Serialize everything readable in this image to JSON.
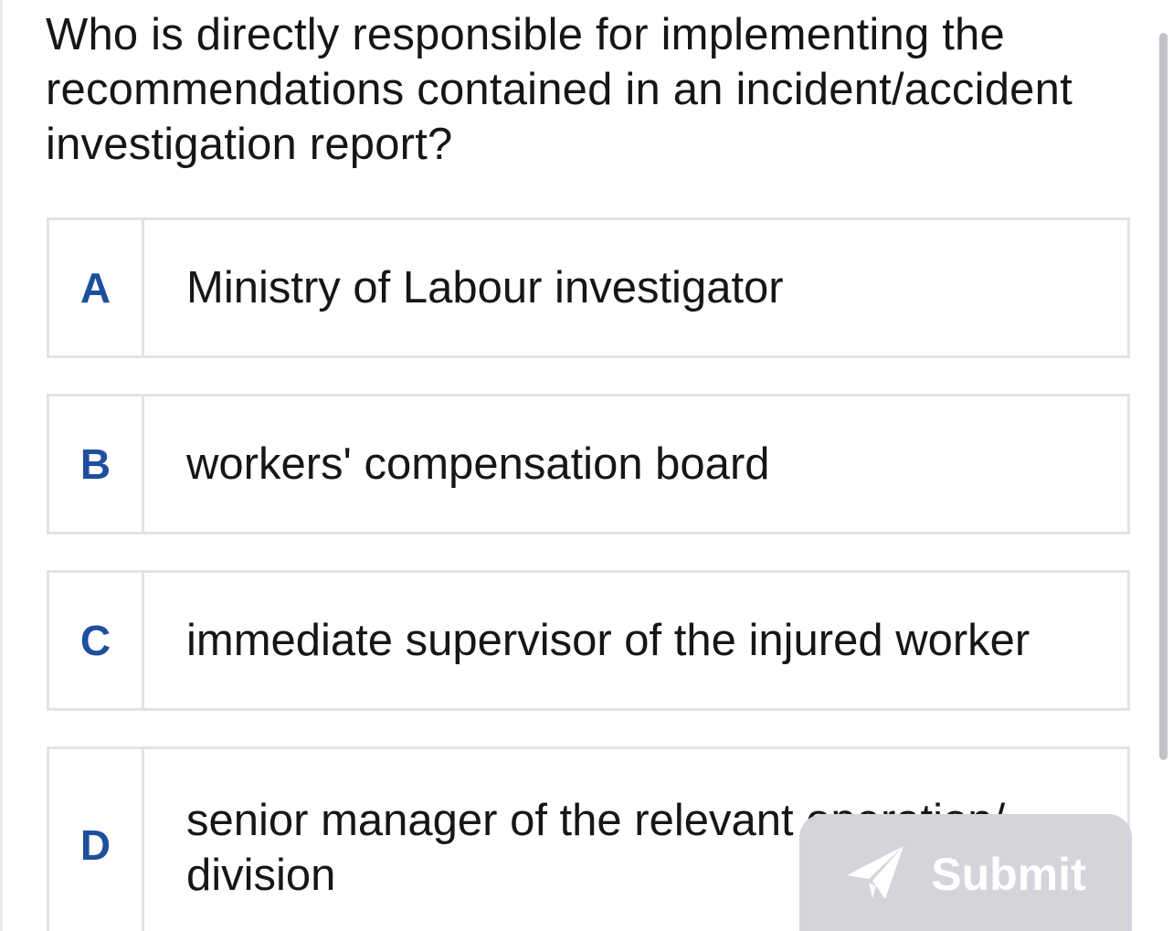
{
  "question": "Who is directly responsible for implementing the recommendations contained in an incident/accident investigation report?",
  "options": [
    {
      "letter": "A",
      "text": "Ministry of Labour investigator"
    },
    {
      "letter": "B",
      "text": "workers' compensation board"
    },
    {
      "letter": "C",
      "text": "immediate supervisor of the injured worker"
    },
    {
      "letter": "D",
      "text": "senior manager of the relevant operation/ division"
    }
  ],
  "submit": {
    "label": "Submit",
    "icon": "send-icon",
    "background": "#d3d5da"
  },
  "colors": {
    "letter": "#1e4f9c",
    "text": "#161616",
    "border": "#e3e3e6"
  }
}
